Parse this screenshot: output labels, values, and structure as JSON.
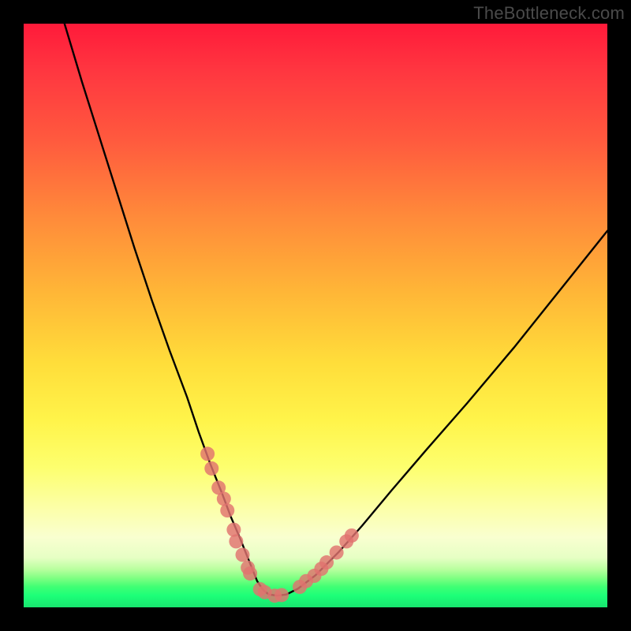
{
  "watermark": "TheBottleneck.com",
  "chart_data": {
    "type": "line",
    "title": "",
    "xlabel": "",
    "ylabel": "",
    "xlim": [
      0,
      100
    ],
    "ylim": [
      0,
      100
    ],
    "grid": false,
    "series": [
      {
        "name": "bottleneck-curve",
        "x": [
          7,
          10,
          13,
          16,
          19,
          22,
          25,
          28,
          30,
          32,
          34,
          35.5,
          37,
          38.2,
          39.2,
          40,
          41,
          42,
          43.5,
          45,
          47,
          50,
          54,
          58,
          63,
          69,
          76,
          84,
          92,
          100
        ],
        "y": [
          100,
          90,
          80.5,
          71,
          61.5,
          52.5,
          44,
          36,
          30,
          24.5,
          19.5,
          15.5,
          12,
          9,
          6.5,
          4.5,
          3,
          2.2,
          2,
          2.2,
          3.2,
          5.5,
          9.5,
          14,
          20,
          27,
          35,
          44.5,
          54.5,
          64.5
        ]
      }
    ],
    "markers": {
      "name": "sample-points",
      "x": [
        31.5,
        32.2,
        33.4,
        34.3,
        34.9,
        36.0,
        36.4,
        37.5,
        38.4,
        38.8,
        40.5,
        41.3,
        43.0,
        44.2,
        47.3,
        48.4,
        49.8,
        51.0,
        51.9,
        53.6,
        55.3,
        56.2
      ],
      "y": [
        26.3,
        23.8,
        20.5,
        18.6,
        16.6,
        13.3,
        11.3,
        9.0,
        6.8,
        5.8,
        3.1,
        2.6,
        2.0,
        2.1,
        3.5,
        4.5,
        5.4,
        6.6,
        7.7,
        9.4,
        11.3,
        12.3
      ]
    },
    "gradient_stops": [
      {
        "pos": 0.0,
        "color": "#ff1a3a"
      },
      {
        "pos": 0.33,
        "color": "#ff8a3a"
      },
      {
        "pos": 0.68,
        "color": "#fff44a"
      },
      {
        "pos": 0.88,
        "color": "#f9ffd0"
      },
      {
        "pos": 0.96,
        "color": "#3fff74"
      },
      {
        "pos": 1.0,
        "color": "#18e56f"
      }
    ]
  }
}
